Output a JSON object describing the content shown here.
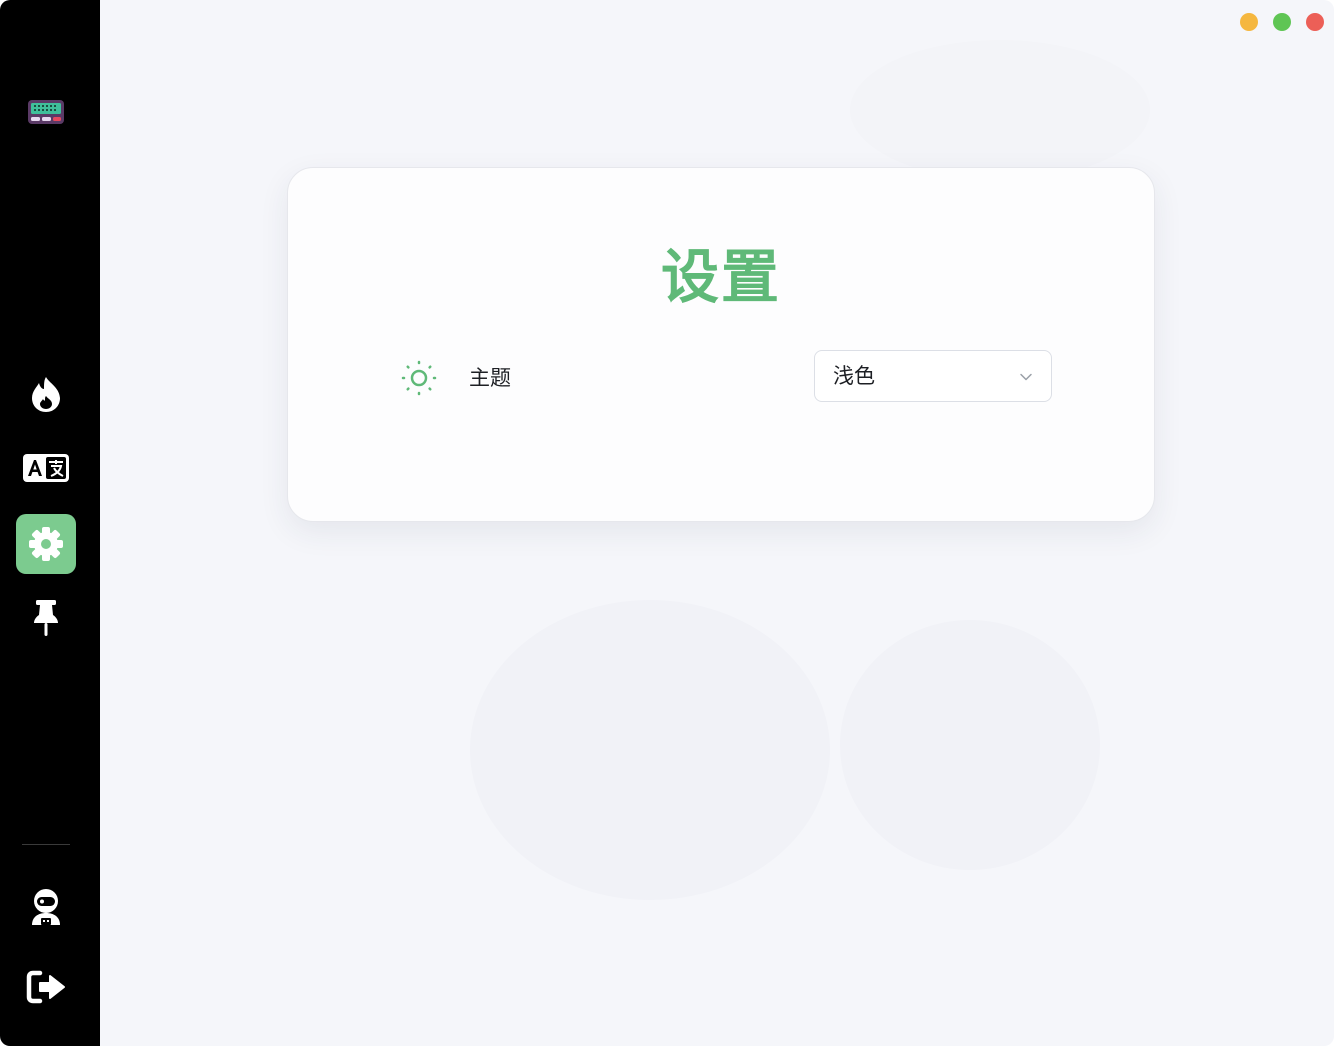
{
  "window": {
    "controls": [
      {
        "name": "minimize",
        "color": "#f5b73f"
      },
      {
        "name": "maximize",
        "color": "#5fc554"
      },
      {
        "name": "close",
        "color": "#ec5f57"
      }
    ]
  },
  "sidebar": {
    "logo_icon": "keyboard-icon",
    "items": [
      {
        "id": "hot",
        "icon": "flame-icon",
        "active": false
      },
      {
        "id": "translate",
        "icon": "translate-icon",
        "active": false
      },
      {
        "id": "settings",
        "icon": "gear-icon",
        "active": true
      },
      {
        "id": "pin",
        "icon": "pin-icon",
        "active": false
      }
    ],
    "bottom_items": [
      {
        "id": "account",
        "icon": "astronaut-icon"
      },
      {
        "id": "logout",
        "icon": "logout-icon"
      }
    ],
    "active_color": "#7ccb8f"
  },
  "settings": {
    "title": "设置",
    "title_color": "#5fb978",
    "theme_row": {
      "icon": "sun-icon",
      "label": "主题",
      "select": {
        "value": "浅色"
      }
    }
  }
}
